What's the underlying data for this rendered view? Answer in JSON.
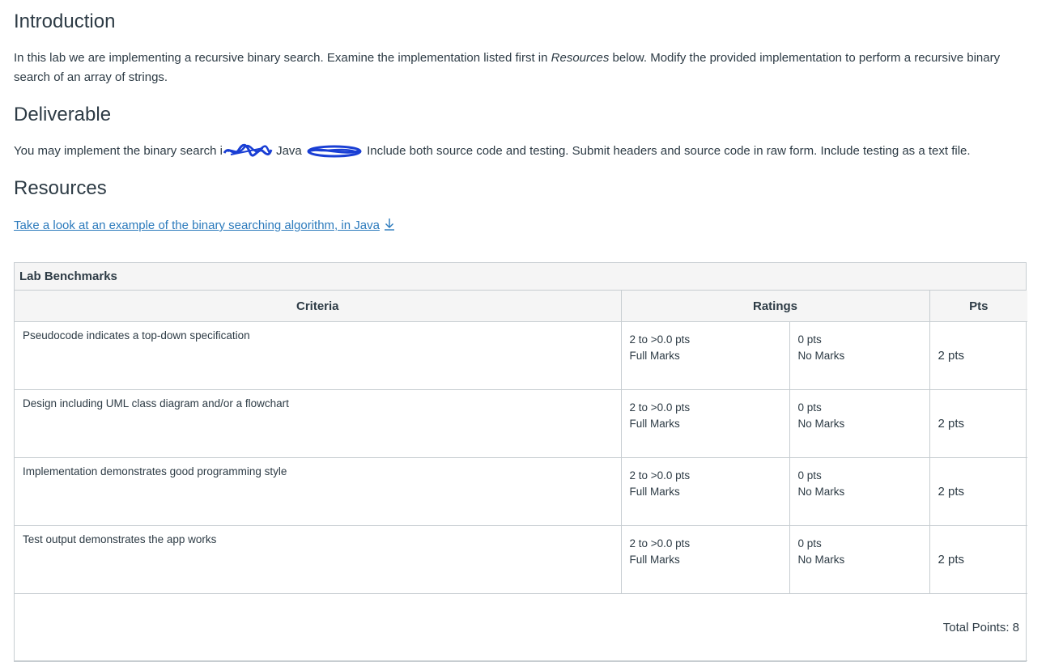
{
  "intro": {
    "heading": "Introduction",
    "text_before_em": "In this lab we are implementing a recursive binary search. Examine the implementation listed first in ",
    "em": "Resources",
    "text_after_em": " below. Modify the provided implementation to perform a recursive binary search of an array of strings."
  },
  "deliverable": {
    "heading": "Deliverable",
    "text_part1": "You may implement the binary search i",
    "text_part2": " Java ",
    "text_part3": " Include both source code and testing. Submit headers and source code in raw form. Include testing as a text file."
  },
  "resources": {
    "heading": "Resources",
    "link_text": "Take a look at an example of the binary searching algorithm, in Java",
    "link_icon": "download-icon"
  },
  "rubric": {
    "caption": "Lab Benchmarks",
    "headers": {
      "criteria": "Criteria",
      "ratings": "Ratings",
      "pts": "Pts"
    },
    "rows": [
      {
        "criterion": "Pseudocode indicates a top-down specification",
        "r1_pts": "2 to >0.0 pts",
        "r1_desc": "Full Marks",
        "r2_pts": "0 pts",
        "r2_desc": "No Marks",
        "points": "2 pts"
      },
      {
        "criterion": "Design including UML class diagram and/or a flowchart",
        "r1_pts": "2 to >0.0 pts",
        "r1_desc": "Full Marks",
        "r2_pts": "0 pts",
        "r2_desc": "No Marks",
        "points": "2 pts"
      },
      {
        "criterion": "Implementation demonstrates good programming style",
        "r1_pts": "2 to >0.0 pts",
        "r1_desc": "Full Marks",
        "r2_pts": "0 pts",
        "r2_desc": "No Marks",
        "points": "2 pts"
      },
      {
        "criterion": "Test output demonstrates the app works",
        "r1_pts": "2 to >0.0 pts",
        "r1_desc": "Full Marks",
        "r2_pts": "0 pts",
        "r2_desc": "No Marks",
        "points": "2 pts"
      }
    ],
    "total": "Total Points: 8"
  },
  "colors": {
    "text": "#2d3b45",
    "link": "#2b7abc",
    "border": "#c7cdd1",
    "header_bg": "#f5f5f5",
    "redaction": "#1a3fd4"
  }
}
